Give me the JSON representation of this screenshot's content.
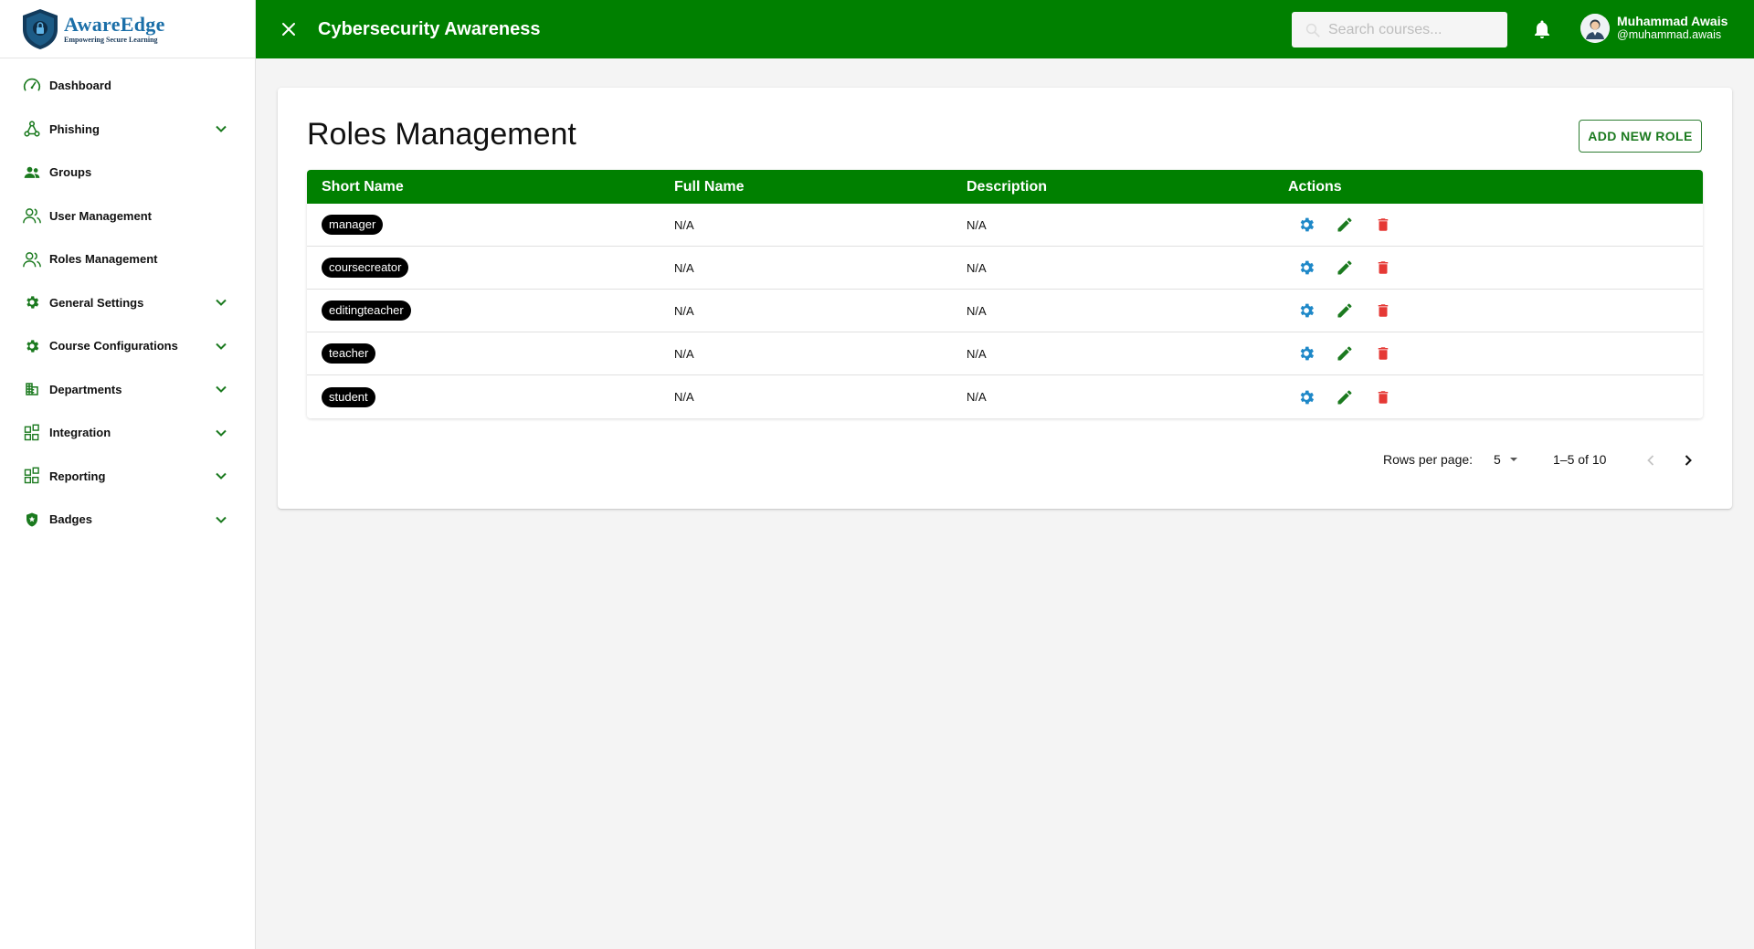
{
  "brand": {
    "name": "AwareEdge",
    "tagline": "Empowering Secure Learning"
  },
  "sidebar": {
    "items": [
      {
        "label": "Dashboard",
        "icon": "speedometer-icon",
        "expandable": false
      },
      {
        "label": "Phishing",
        "icon": "webhook-icon",
        "expandable": true
      },
      {
        "label": "Groups",
        "icon": "people-icon",
        "expandable": false
      },
      {
        "label": "User Management",
        "icon": "users-icon",
        "expandable": false
      },
      {
        "label": "Roles Management",
        "icon": "users-icon",
        "expandable": false
      },
      {
        "label": "General Settings",
        "icon": "gear-icon",
        "expandable": true
      },
      {
        "label": "Course Configurations",
        "icon": "gear-icon",
        "expandable": true
      },
      {
        "label": "Departments",
        "icon": "building-icon",
        "expandable": true
      },
      {
        "label": "Integration",
        "icon": "widgets-icon",
        "expandable": true
      },
      {
        "label": "Reporting",
        "icon": "widgets-icon",
        "expandable": true
      },
      {
        "label": "Badges",
        "icon": "badge-shield-icon",
        "expandable": true
      }
    ]
  },
  "topbar": {
    "title": "Cybersecurity Awareness",
    "search_placeholder": "Search courses...",
    "user_name": "Muhammad Awais",
    "user_handle": "@muhammad.awais"
  },
  "main": {
    "title": "Roles Management",
    "add_button": "ADD NEW ROLE",
    "table": {
      "headers": [
        "Short Name",
        "Full Name",
        "Description",
        "Actions"
      ],
      "rows": [
        {
          "short": "manager",
          "full": "N/A",
          "desc": "N/A"
        },
        {
          "short": "coursecreator",
          "full": "N/A",
          "desc": "N/A"
        },
        {
          "short": "editingteacher",
          "full": "N/A",
          "desc": "N/A"
        },
        {
          "short": "teacher",
          "full": "N/A",
          "desc": "N/A"
        },
        {
          "short": "student",
          "full": "N/A",
          "desc": "N/A"
        }
      ]
    },
    "pagination": {
      "rows_per_page_label": "Rows per page:",
      "rows_per_page": "5",
      "range": "1–5 of 10"
    }
  },
  "colors": {
    "primary": "#008000",
    "settings_icon": "#1e88c8",
    "edit_icon": "#1b7a1f",
    "delete_icon": "#e53935",
    "chip_bg": "#000000"
  }
}
